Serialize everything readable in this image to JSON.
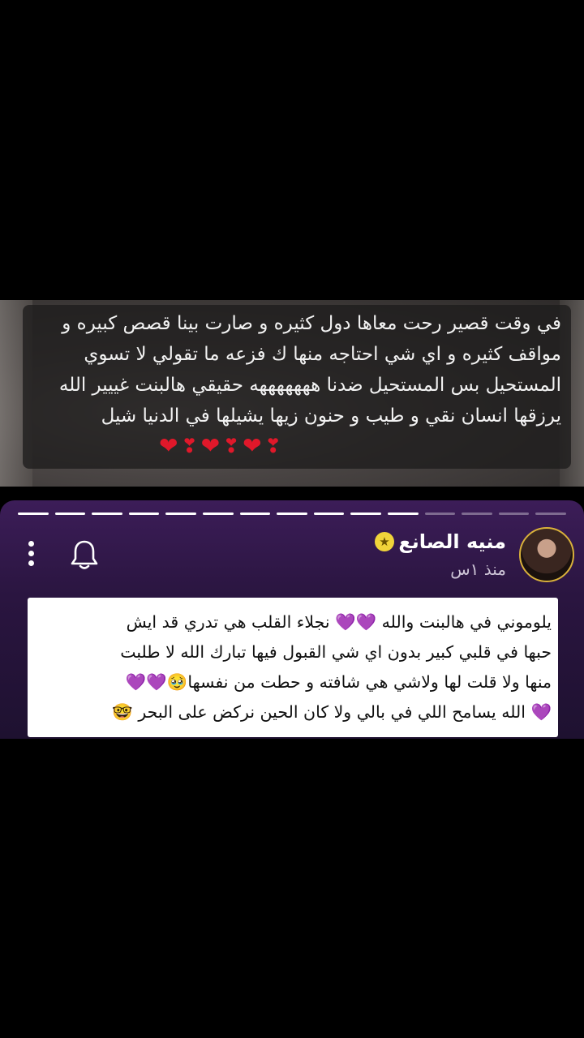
{
  "quote": {
    "text": "في وقت قصير رحت معاها دول كثيره و صارت بينا قصص كبيره و مواقف كثيره و اي شي احتاجه منها ك فزعه ما تقولي لا تسوي المستحيل بس المستحيل ضدنا هههههههه حقيقي هالبنت غييير الله يرزقها انسان نقي و طيب و حنون زيها يشيلها في الدنيا شيل",
    "hearts": "❣️❤️❣️❤️❣️❤️"
  },
  "post": {
    "user_name": "منيه الصانع",
    "time_ago": "منذ ١س",
    "progress_total": 15,
    "progress_done": 11
  },
  "comment": {
    "line1": "يلوموني في هالبنت والله 💜💜 نجلاء القلب هي تدري قد ايش",
    "line2": "حبها في قلبي كبير بدون اي شي القبول فيها تبارك الله لا طلبت",
    "line3": "منها ولا قلت لها ولاشي هي شافته و حطت من نفسها🥹💜💜",
    "line4": "💜 الله يسامح اللي في بالي ولا كان الحين نركض على البحر 🤓"
  },
  "colors": {
    "accent_purple": "#8b2fd9",
    "heart_red": "#e0182a",
    "badge_yellow": "#f0d43a",
    "panel_purple": "#3c1d58"
  },
  "icons": [
    "more-vertical-icon",
    "bell-icon",
    "star-badge-icon"
  ]
}
